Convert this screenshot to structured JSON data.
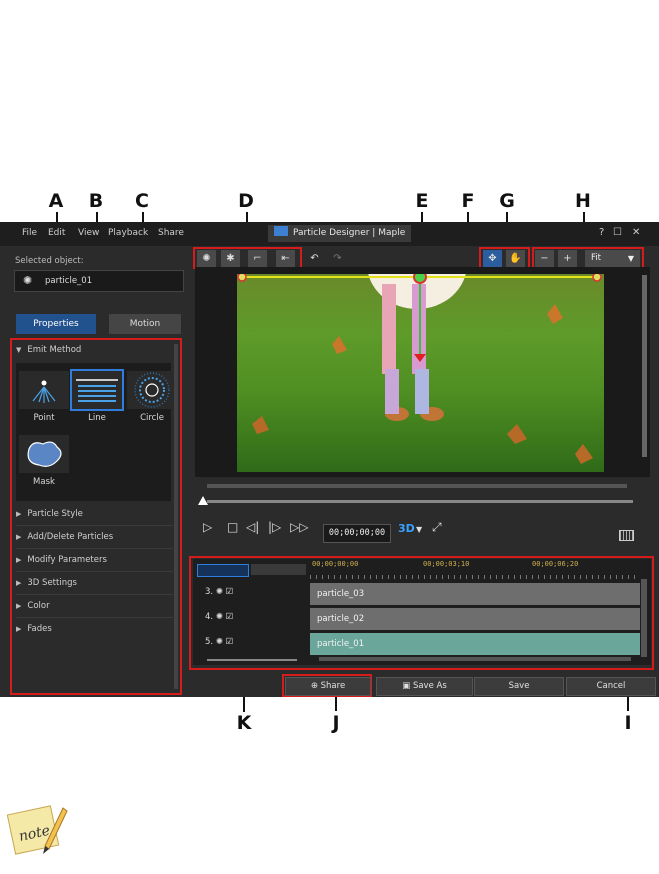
{
  "callouts": [
    "A",
    "B",
    "C",
    "D",
    "E",
    "F",
    "G",
    "H",
    "I",
    "J",
    "K"
  ],
  "app": {
    "menu": [
      "File",
      "Edit",
      "View",
      "Playback",
      "Share"
    ],
    "title": "Particle Designer",
    "project": "Maple",
    "window_controls": [
      "?",
      "☐",
      "✕"
    ]
  },
  "left_panel": {
    "selected_label": "Selected object:",
    "selected_value": "particle_01",
    "tabs": [
      "Properties",
      "Motion"
    ],
    "emit_method_title": "Emit Method",
    "emit_options": [
      "Point",
      "Line",
      "Circle",
      "Mask"
    ],
    "sections": [
      "Particle Style",
      "Add/Delete Particles",
      "Modify Parameters",
      "3D Settings",
      "Color",
      "Fades"
    ]
  },
  "preview": {
    "zoom": "Fit"
  },
  "playback": {
    "timecode": "00;00;00;00",
    "mode_3d": "3D"
  },
  "timeline": {
    "markers": [
      "00;00;00;00",
      "00;00;03;10",
      "00;00;06;20"
    ],
    "rows": [
      {
        "num": "3.",
        "name": "particle_03"
      },
      {
        "num": "4.",
        "name": "particle_02"
      },
      {
        "num": "5.",
        "name": "particle_01"
      }
    ]
  },
  "bottom_buttons": {
    "share": "Share",
    "save_as": "Save As",
    "save": "Save",
    "cancel": "Cancel"
  },
  "colors": {
    "accent_blue": "#21528e",
    "callout_red": "#d41c1c",
    "track_selected": "#6aa79a",
    "track_normal": "#6e6e6e"
  }
}
